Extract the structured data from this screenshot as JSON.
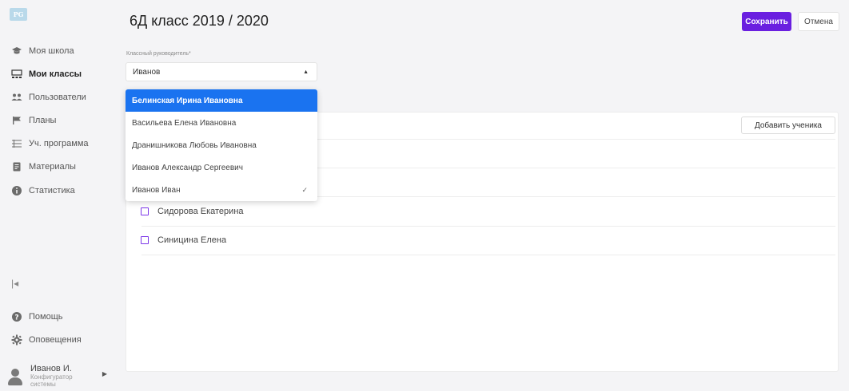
{
  "sidebar": {
    "logo": "PG",
    "items": [
      {
        "label": "Моя школа"
      },
      {
        "label": "Мои классы"
      },
      {
        "label": "Пользователи"
      },
      {
        "label": "Планы"
      },
      {
        "label": "Уч. программа"
      },
      {
        "label": "Материалы"
      },
      {
        "label": "Статистика"
      }
    ],
    "help": "Помощь",
    "notifications": "Оповещения",
    "user": {
      "name": "Иванов И.",
      "role_line1": "Конфигуратор",
      "role_line2": "системы"
    }
  },
  "header": {
    "title": "6Д класс 2019 / 2020",
    "save_label": "Сохранить",
    "cancel_label": "Отмена"
  },
  "form": {
    "label": "Классный руководитель*",
    "value": "Иванов"
  },
  "dropdown": {
    "options": [
      "Белинская Ирина Ивановна",
      "Васильева Елена Ивановна",
      "Дранишникова Любовь Ивановна",
      "Иванов Александр Сергеевич",
      "Иванов Иван"
    ],
    "highlighted_index": 0,
    "selected_index": 4
  },
  "students": {
    "add_label": "Добавить ученика",
    "list": [
      "Сидорова Екатерина",
      "Синицина Елена"
    ]
  },
  "colors": {
    "primary": "#6a1fe0",
    "highlight": "#1a73f0",
    "checkbox": "#7b35e8"
  }
}
